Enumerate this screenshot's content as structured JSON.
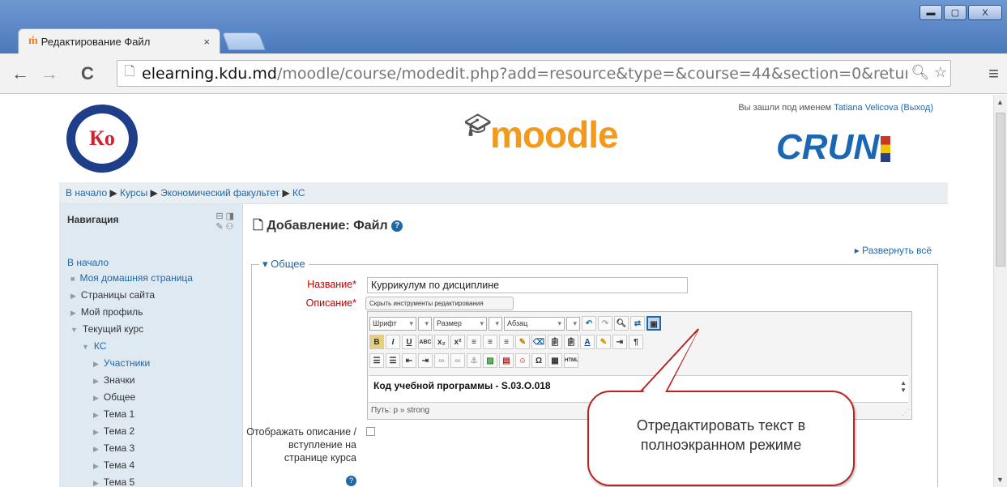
{
  "browser": {
    "tab_title": "Редактирование Файл",
    "tab_favicon": "ṁ",
    "tab_close": "×",
    "url_host": "elearning.kdu.md",
    "url_path": "/moodle/course/modedit.php?add=resource&type=&course=44&section=0&return",
    "window_min": "▬",
    "window_max": "▢",
    "window_close": "X"
  },
  "header": {
    "logo_kdu_text": "Кo",
    "moodle_text": "moodle",
    "crun_text": "CRUN",
    "login_prefix": "Вы зашли под именем",
    "login_user": "Tatiana Velicova",
    "login_logout": "(Выход)"
  },
  "breadcrumb": {
    "items": [
      "В начало",
      "Курсы",
      "Экономический факультет",
      "КС"
    ],
    "sep": "▶"
  },
  "sidebar": {
    "title": "Навигация",
    "items": [
      {
        "label": "В начало"
      },
      {
        "label": "Моя домашняя страница"
      },
      {
        "label": "Страницы сайта"
      },
      {
        "label": "Мой профиль"
      },
      {
        "label": "Текущий курс"
      },
      {
        "label": "КС"
      },
      {
        "label": "Участники"
      },
      {
        "label": "Значки"
      },
      {
        "label": "Общее"
      },
      {
        "label": "Тема 1"
      },
      {
        "label": "Тема 2"
      },
      {
        "label": "Тема 3"
      },
      {
        "label": "Тема 4"
      },
      {
        "label": "Тема 5"
      }
    ]
  },
  "main": {
    "title": "Добавление: Файл",
    "expand_all": "Развернуть всё",
    "legend": "Общее",
    "name_label": "Название",
    "name_value": "Куррикулум по дисциплине",
    "desc_label": "Описание",
    "toggle_editor": "Скрыть инструменты редактирования",
    "font_select": "Шрифт",
    "size_select": "Размер",
    "format_select": "Абзац",
    "editor_content": "Код учебной программы   - S.03.O.018",
    "path_label": "Путь: p » strong",
    "display_label": "Отображать описание / вступление на странице курса"
  },
  "callout": {
    "line1": "Отредактировать текст в",
    "line2": "полноэкранном режиме"
  },
  "colors": {
    "accent": "#2067a6",
    "required": "#bb0000",
    "callout_border": "#bb2222"
  }
}
